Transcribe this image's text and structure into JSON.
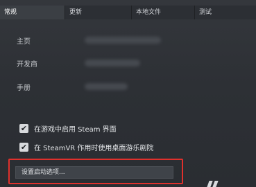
{
  "tabs": [
    {
      "label": "常规",
      "active": true
    },
    {
      "label": "更新",
      "active": false
    },
    {
      "label": "本地文件",
      "active": false
    },
    {
      "label": "测试",
      "active": false
    }
  ],
  "info": {
    "homepage_label": "主页",
    "developer_label": "开发商",
    "manual_label": "手册"
  },
  "options": {
    "overlay_label": "在游戏中启用 Steam 界面",
    "overlay_checked": true,
    "desktop_theatre_label": "在 SteamVR 作用时使用桌面游乐剧院",
    "desktop_theatre_checked": true,
    "checkmark": "✔"
  },
  "launch_button_label": "设置启动选项...",
  "colors": {
    "highlight": "#e0302c",
    "background": "#2b2e33"
  }
}
